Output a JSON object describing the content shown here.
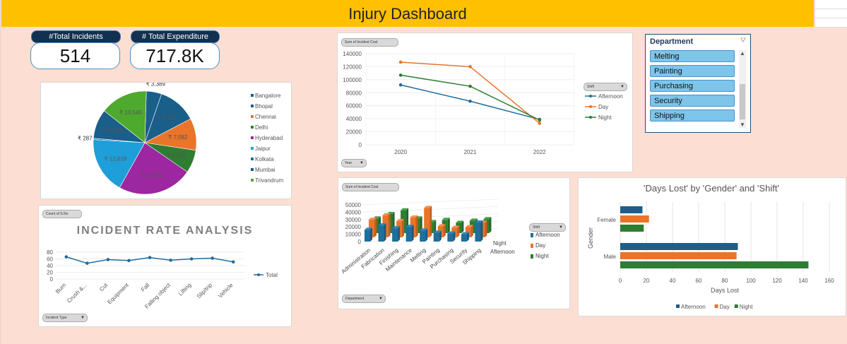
{
  "title": "Injury Dashboard",
  "kpis": {
    "incidents_label": "#Total Incidents",
    "incidents_value": "514",
    "expenditure_label": "# Total Expenditure",
    "expenditure_value": "717.8K"
  },
  "pie": {
    "legend": [
      "Bangalore",
      "Bhopal",
      "Chennai",
      "Delhi",
      "Hyderabad",
      "Jaipur",
      "Kolkata",
      "Mumbai",
      "Trivandrum"
    ],
    "colors": [
      "#1a5e8a",
      "#1a5e8a",
      "#e9742a",
      "#2e7d32",
      "#9c27a0",
      "#1f9fd9",
      "#1f6fa0",
      "#1a5e8a",
      "#4ea92f"
    ],
    "labels": [
      "₹ 3,389",
      "₹ 8,550",
      "₹ 7,082",
      "₹ 5,118",
      "₹ 16,652",
      "₹ 12,618",
      "₹ 287",
      "₹ 6,505",
      "₹ 10,545"
    ]
  },
  "rate_chart": {
    "pill": "Count of S.No",
    "title": "INCIDENT RATE ANALYSIS",
    "footer_pill": "Incident Type",
    "legend": "Total",
    "chart_data": {
      "type": "line",
      "categories": [
        "Burn",
        "Crush &...",
        "Cut",
        "Equipment",
        "Fall",
        "Falling object",
        "Lifting",
        "Slip/trip",
        "Vehicle"
      ],
      "values": [
        66,
        47,
        58,
        55,
        64,
        56,
        60,
        62,
        51
      ],
      "ylim": [
        0,
        80
      ],
      "yticks": [
        "0",
        "20",
        "40",
        "60",
        "80"
      ]
    }
  },
  "year_chart": {
    "pill": "Sum of Incident Cost",
    "footer_pill": "Year",
    "legend_title": "Shift",
    "chart_data": {
      "type": "line",
      "categories": [
        "2020",
        "2021",
        "2022"
      ],
      "series": [
        {
          "name": "Afternoon",
          "values": [
            92000,
            67000,
            39000
          ],
          "color": "#1f6e9c"
        },
        {
          "name": "Day",
          "values": [
            127000,
            120000,
            33000
          ],
          "color": "#e9742a"
        },
        {
          "name": "Night",
          "values": [
            107000,
            90000,
            38000
          ],
          "color": "#2e7d32"
        }
      ],
      "ylim": [
        0,
        140000
      ],
      "yticks": [
        "0",
        "20000",
        "40000",
        "60000",
        "80000",
        "100000",
        "120000",
        "140000"
      ]
    }
  },
  "dept_chart": {
    "pill": "Sum of Incident Cost",
    "footer_pill": "Department",
    "legend_title": "Shift",
    "depth_labels": [
      "Night",
      "Afternoon"
    ],
    "chart_data": {
      "type": "bar",
      "categories": [
        "Administration",
        "Fabrication",
        "Finishing",
        "Maintenance",
        "Melting",
        "Painting",
        "Purchasing",
        "Security",
        "Shipping"
      ],
      "series": [
        {
          "name": "Afternoon",
          "values": [
            16000,
            22000,
            18000,
            20000,
            15000,
            12000,
            11000,
            10000,
            26000
          ],
          "color": "#1f6e9c"
        },
        {
          "name": "Day",
          "values": [
            24000,
            30000,
            22000,
            27000,
            40000,
            15000,
            13000,
            14000,
            20000
          ],
          "color": "#e9742a"
        },
        {
          "name": "Night",
          "values": [
            20000,
            26000,
            31000,
            20000,
            15000,
            18000,
            14000,
            17000,
            19000
          ],
          "color": "#2e7d32"
        }
      ],
      "ylim": [
        0,
        50000
      ],
      "yticks": [
        "0",
        "10000",
        "20000",
        "30000",
        "40000",
        "50000"
      ]
    }
  },
  "days_chart": {
    "title": "'Days Lost' by 'Gender'  and 'Shift'",
    "xlabel": "Days Lost",
    "ylabel": "Gender",
    "chart_data": {
      "type": "bar",
      "categories": [
        "Female",
        "Male"
      ],
      "series": [
        {
          "name": "Afternoon",
          "values": [
            17,
            90
          ],
          "color": "#1f5e88"
        },
        {
          "name": "Day",
          "values": [
            22,
            89
          ],
          "color": "#e9742a"
        },
        {
          "name": "Night",
          "values": [
            18,
            144
          ],
          "color": "#2e7d32"
        }
      ],
      "xlim": [
        0,
        160
      ],
      "xticks": [
        "0",
        "20",
        "40",
        "60",
        "80",
        "100",
        "120",
        "140",
        "160"
      ]
    }
  },
  "slicer": {
    "title": "Department",
    "items": [
      "Melting",
      "Painting",
      "Purchasing",
      "Security",
      "Shipping"
    ]
  }
}
